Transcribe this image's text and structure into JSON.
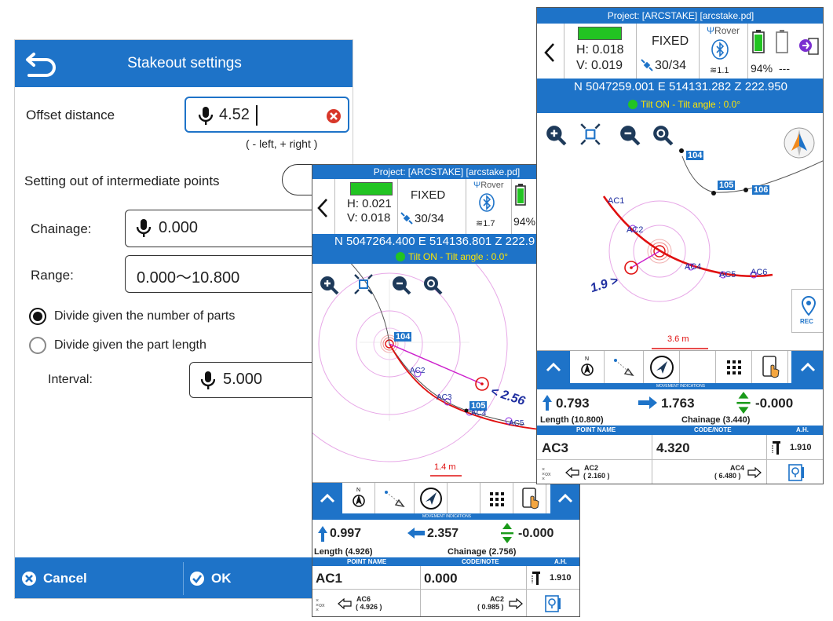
{
  "settings": {
    "title": "Stakeout settings",
    "offset_label": "Offset distance",
    "offset_value": "4.52",
    "offset_hint": "( - left, + right )",
    "intermediate_label": "Setting out of intermediate points",
    "chainage_label": "Chainage:",
    "chainage_value": "0.000",
    "range_label": "Range:",
    "range_value": "0.000～10.800",
    "radio_parts_label": "Divide given the number of parts",
    "radio_length_label": "Divide given the part length",
    "interval_label": "Interval:",
    "interval_value": "5.000",
    "cancel_label": "Cancel",
    "ok_label": "OK"
  },
  "screen_a": {
    "project": "Project: [ARCSTAKE] [arcstake.pd]",
    "h": "H: 0.021",
    "v": "V: 0.018",
    "fix": "FIXED",
    "sats": "30/34",
    "rover": "Rover",
    "bt": "1.7",
    "battery": "94%",
    "coords": "N 5047264.400   E 514136.801   Z 222.9",
    "tilt": "Tilt ON - Tilt angle : 0.0°",
    "points": {
      "p104": "104",
      "p105": "105",
      "ac2": "AC2",
      "ac3": "AC3",
      "ac4": "AC4",
      "ac5": "AC5"
    },
    "distance_arrow": "< 2.56",
    "scale": "1.4 m",
    "movement_title": "MOVEMENT INDICATIONS",
    "move_north": "0.997",
    "move_east": "2.357",
    "move_height": "-0.000",
    "length": "Length (4.926)",
    "chainage": "Chainage (2.756)",
    "col_point": "POINT NAME",
    "col_code": "CODE/NOTE",
    "col_ah": "A.H.",
    "point_name": "AC1",
    "code": "0.000",
    "ah": "1.910",
    "prev_name": "AC6",
    "prev_val": "( 4.926 )",
    "next_name": "AC2",
    "next_val": "( 0.985 )"
  },
  "screen_b": {
    "project": "Project: [ARCSTAKE] [arcstake.pd]",
    "h": "H: 0.018",
    "v": "V: 0.019",
    "fix": "FIXED",
    "sats": "30/34",
    "rover": "Rover",
    "bt": "1.1",
    "battery": "94%",
    "battery2": "---",
    "coords": "N 5047259.001   E 514131.282   Z 222.950",
    "tilt": "Tilt ON - Tilt angle : 0.0°",
    "points": {
      "p104": "104",
      "p105": "105",
      "p106": "106",
      "ac1": "AC1",
      "ac2": "AC2",
      "ac4": "AC4",
      "ac5": "AC5",
      "ac6": "AC6"
    },
    "distance_arrow": "1.9 >",
    "scale": "3.6 m",
    "rec": "REC",
    "movement_title": "MOVEMENT INDICATIONS",
    "move_north": "0.793",
    "move_east": "1.763",
    "move_height": "-0.000",
    "length": "Length (10.800)",
    "chainage": "Chainage (3.440)",
    "col_point": "POINT NAME",
    "col_code": "CODE/NOTE",
    "col_ah": "A.H.",
    "point_name": "AC3",
    "code": "4.320",
    "ah": "1.910",
    "prev_name": "AC2",
    "prev_val": "( 2.160 )",
    "next_name": "AC4",
    "next_val": "( 6.480 )"
  },
  "colors": {
    "primary": "#1e73c8",
    "fix_green": "#22c422",
    "stake_red": "#e01010",
    "tilt_yellow": "#ffe600",
    "height_green": "#1a9a1a"
  }
}
